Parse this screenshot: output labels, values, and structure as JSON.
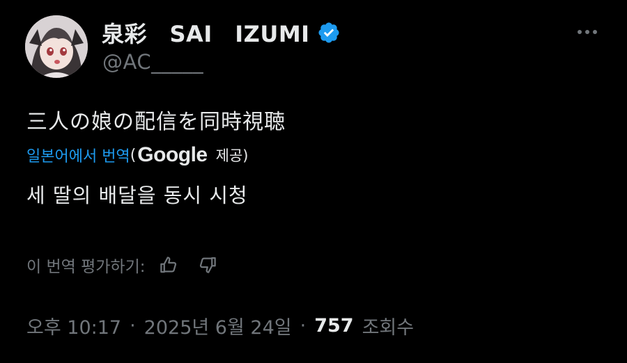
{
  "author": {
    "display_name": "泉彩　SAI　IZUMI",
    "handle": "@AC_____",
    "verified_icon": "verified-badge-icon",
    "avatar_icon": "anime-girl-avatar"
  },
  "menu": {
    "more_icon": "more-horizontal-icon"
  },
  "tweet": {
    "text": "三人の娘の配信を同時視聴",
    "translate_link": "일본어에서 번역",
    "translate_provider_open": "(",
    "translate_provider_name": "Google",
    "translate_provider_suffix": "제공)",
    "translated_text": "세 딸의 배달을 동시 시청"
  },
  "rating": {
    "label": "이 번역 평가하기:",
    "thumbs_up_icon": "thumbs-up-icon",
    "thumbs_down_icon": "thumbs-down-icon"
  },
  "meta": {
    "time": "오후 10:17",
    "separator": "·",
    "date": "2025년 6월 24일",
    "views_count": "757",
    "views_label": "조회수"
  },
  "colors": {
    "background": "#000000",
    "text_primary": "#e7e9ea",
    "text_secondary": "#71767b",
    "link": "#1d9bf0",
    "verified": "#1d9bf0"
  }
}
